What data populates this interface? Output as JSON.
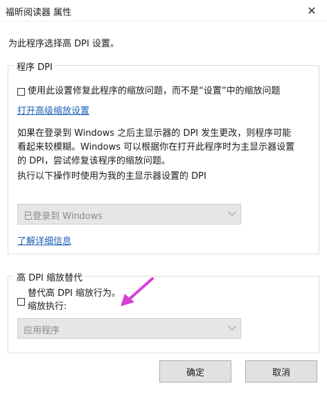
{
  "window": {
    "title": "福昕阅读器 属性",
    "close_glyph": "✕"
  },
  "prompt": "为此程序选择高 DPI 设置。",
  "program_dpi": {
    "legend": "程序 DPI",
    "checkbox_label": "使用此设置修复此程序的缩放问题，而不是“设置”中的缩放问题",
    "advanced_link": "打开高级缩放设置",
    "description_line1": "如果在登录到 Windows 之后主显示器的 DPI 发生更改，则程序可能",
    "description_line2": "看起来较模糊。Windows 可以根据你在打开此程序时为主显示器设置",
    "description_line3": "的 DPI，尝试修复该程序的缩放问题。",
    "select_label": "执行以下操作时使用为我的主显示器设置的 DPI",
    "select_value": "已登录到 Windows",
    "learn_more_link": "了解详细信息"
  },
  "override": {
    "legend": "高 DPI 缩放替代",
    "checkbox_label": "替代高 DPI 缩放行为。",
    "sub_label": "缩放执行:",
    "select_value": "应用程序"
  },
  "buttons": {
    "ok": "确定",
    "cancel": "取消"
  },
  "accent": {
    "annotation_arrow": "#d63fd6",
    "link": "#1a5fb4"
  }
}
